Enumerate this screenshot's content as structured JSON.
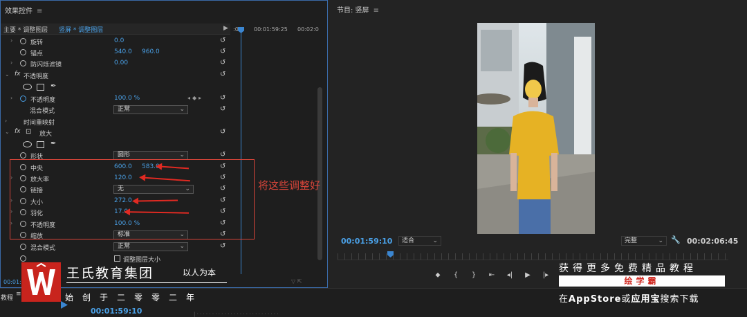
{
  "effects": {
    "title": "效果控件",
    "menu": "≡",
    "tab_master": "主要 * 调整图层",
    "tab_active": "竖屏 * 调整图层",
    "ruler_start": ":00",
    "ruler_mid": "00:01:59:25",
    "ruler_end": "00:02:0",
    "rows": [
      {
        "label": "旋转",
        "v1": "0.0"
      },
      {
        "label": "锚点",
        "v1": "540.0",
        "v2": "960.0"
      },
      {
        "label": "防闪烁滤镜",
        "v1": "0.00"
      }
    ],
    "opacity_section": "不透明度",
    "opacity_value": "100.0 %",
    "opacity_label": "不透明度",
    "blend_label": "混合模式",
    "blend_value": "正常",
    "time_remap": "时间重映射",
    "magnify_section": "放大",
    "shape_label": "形状",
    "shape_value": "圆形",
    "center_label": "中央",
    "center_x": "600.0",
    "center_y": "583.0",
    "mag_label": "放大率",
    "mag_value": "120.0",
    "link_label": "链接",
    "link_value": "无",
    "size_label": "大小",
    "size_value": "272.0",
    "feather_label": "羽化",
    "feather_value": "17.0",
    "opacity2_label": "不透明度",
    "opacity2_value": "100.0 %",
    "scale_label": "缩放",
    "scale_value": "标准",
    "blend2_label": "混合模式",
    "blend2_value": "正常",
    "resize_label": "调整图层大小",
    "current_time": "00:01:59:10",
    "annotation": "将这些调整好"
  },
  "program": {
    "title": "节目: 竖屏",
    "menu": "≡",
    "timecode": "00:01:59:10",
    "fit": "适合",
    "quality": "完整",
    "duration": "00:02:06:45"
  },
  "watermark": {
    "brand_name": "王氏教育集团",
    "motto": "以人为本",
    "founded": "始创于二零零二年",
    "promo_line1": "获得更多免费精品教程",
    "promo_app": "绘学霸",
    "promo_prefix": "在",
    "promo_store": "AppStore",
    "promo_mid": "或",
    "promo_store2": "应用宝",
    "promo_suffix": "搜索下载"
  },
  "timeline": {
    "tab": "教程",
    "menu": "≡",
    "timecode": "00:01:59:10"
  },
  "colors": {
    "accent": "#4aa0e6",
    "annotation_red": "#d8453a",
    "brand_red": "#c8241d"
  }
}
